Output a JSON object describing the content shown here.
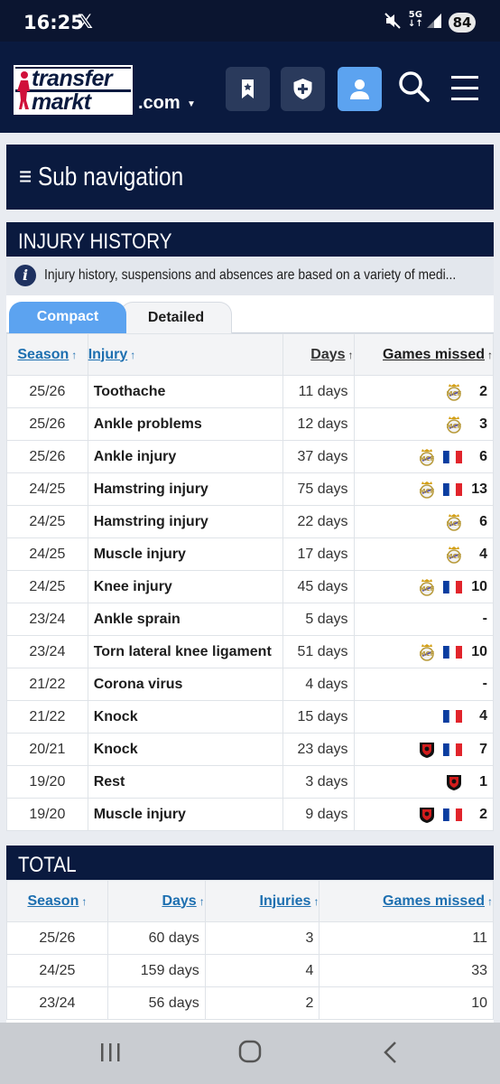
{
  "status_bar": {
    "time": "16:25",
    "x_app": "𝕏",
    "network_top": "5G",
    "network_bottom": "↓↑",
    "battery": "84"
  },
  "header": {
    "logo_line1": "transfer",
    "logo_line2": "markt",
    "domain": ".com",
    "buttons": [
      "bookmark",
      "shield-plus",
      "user"
    ],
    "accent": "#5ca3f0",
    "bg": "#0a1a3f"
  },
  "subnav": {
    "label": "≡ Sub navigation"
  },
  "injury": {
    "title": "INJURY HISTORY",
    "info": "Injury history, suspensions and absences are based on a variety of medi...",
    "tabs": [
      "Compact",
      "Detailed"
    ],
    "headers": {
      "season": "Season",
      "injury": "Injury",
      "days": "Days",
      "games": "Games missed"
    },
    "rows": [
      {
        "season": "25/26",
        "injury": "Toothache",
        "days": "11 days",
        "clubs": [
          "real"
        ],
        "games": "2"
      },
      {
        "season": "25/26",
        "injury": "Ankle problems",
        "days": "12 days",
        "clubs": [
          "real"
        ],
        "games": "3"
      },
      {
        "season": "25/26",
        "injury": "Ankle injury",
        "days": "37 days",
        "clubs": [
          "real",
          "france"
        ],
        "games": "6"
      },
      {
        "season": "24/25",
        "injury": "Hamstring injury",
        "days": "75 days",
        "clubs": [
          "real",
          "france"
        ],
        "games": "13"
      },
      {
        "season": "24/25",
        "injury": "Hamstring injury",
        "days": "22 days",
        "clubs": [
          "real"
        ],
        "games": "6"
      },
      {
        "season": "24/25",
        "injury": "Muscle injury",
        "days": "17 days",
        "clubs": [
          "real"
        ],
        "games": "4"
      },
      {
        "season": "24/25",
        "injury": "Knee injury",
        "days": "45 days",
        "clubs": [
          "real",
          "france"
        ],
        "games": "10"
      },
      {
        "season": "23/24",
        "injury": "Ankle sprain",
        "days": "5 days",
        "clubs": [],
        "games": "-"
      },
      {
        "season": "23/24",
        "injury": "Torn lateral knee ligament",
        "days": "51 days",
        "clubs": [
          "real",
          "france"
        ],
        "games": "10"
      },
      {
        "season": "21/22",
        "injury": "Corona virus",
        "days": "4 days",
        "clubs": [],
        "games": "-"
      },
      {
        "season": "21/22",
        "injury": "Knock",
        "days": "15 days",
        "clubs": [
          "france"
        ],
        "games": "4"
      },
      {
        "season": "20/21",
        "injury": "Knock",
        "days": "23 days",
        "clubs": [
          "rennes",
          "france"
        ],
        "games": "7"
      },
      {
        "season": "19/20",
        "injury": "Rest",
        "days": "3 days",
        "clubs": [
          "rennes"
        ],
        "games": "1"
      },
      {
        "season": "19/20",
        "injury": "Muscle injury",
        "days": "9 days",
        "clubs": [
          "rennes",
          "france"
        ],
        "games": "2"
      }
    ]
  },
  "total": {
    "title": "TOTAL",
    "headers": {
      "season": "Season",
      "days": "Days",
      "injuries": "Injuries",
      "games": "Games missed"
    },
    "rows": [
      {
        "season": "25/26",
        "days": "60 days",
        "injuries": "3",
        "games": "11"
      },
      {
        "season": "24/25",
        "days": "159 days",
        "injuries": "4",
        "games": "33"
      },
      {
        "season": "23/24",
        "days": "56 days",
        "injuries": "2",
        "games": "10"
      }
    ]
  }
}
